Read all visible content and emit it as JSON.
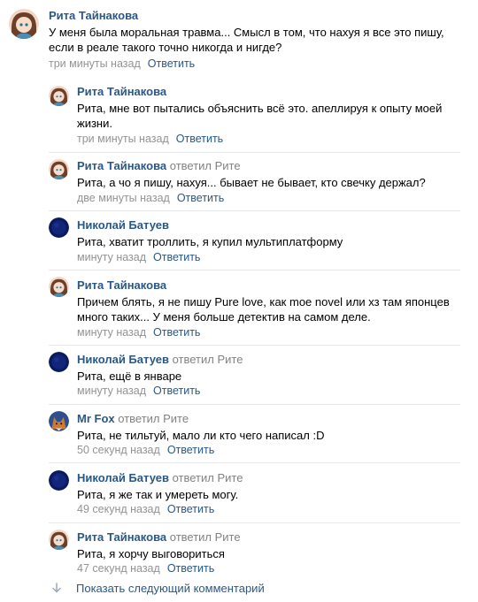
{
  "comments": [
    {
      "author": "Рита Тайнакова",
      "reply_to": "",
      "text": "У меня была моральная травма... Смысл в том, что нахуя я все это пишу, если в реале такого точно никогда и нигде?",
      "time": "три минуты назад",
      "reply_label": "Ответить",
      "avatar": "rita"
    },
    {
      "author": "Рита Тайнакова",
      "reply_to": "",
      "text": "Рита, мне вот пытались объяснить всё это. апеллируя к опыту моей жизни.",
      "time": "три минуты назад",
      "reply_label": "Ответить",
      "avatar": "rita"
    },
    {
      "author": "Рита Тайнакова",
      "reply_to": "ответил Рите",
      "text": "Рита, а чо я пишу, нахуя... бывает не бывает, кто свечку держал?",
      "time": "две минуты назад",
      "reply_label": "Ответить",
      "avatar": "rita"
    },
    {
      "author": "Николай Батуев",
      "reply_to": "",
      "text": "Рита, хватит троллить, я купил мультиплатформу",
      "time": "минуту назад",
      "reply_label": "Ответить",
      "avatar": "nikolai"
    },
    {
      "author": "Рита Тайнакова",
      "reply_to": "",
      "text": "Причем блять, я не пишу Pure love, как moe novel или хз там японцев много таких... У меня больше детектив на самом деле.",
      "time": "минуту назад",
      "reply_label": "Ответить",
      "avatar": "rita"
    },
    {
      "author": "Николай Батуев",
      "reply_to": "ответил Рите",
      "text": "Рита, ещё в январе",
      "time": "минуту назад",
      "reply_label": "Ответить",
      "avatar": "nikolai"
    },
    {
      "author": "Mr Fox",
      "reply_to": "ответил Рите",
      "text": "Рита, не тильтуй, мало ли кто чего написал :D",
      "time": "50 секунд назад",
      "reply_label": "Ответить",
      "avatar": "fox"
    },
    {
      "author": "Николай Батуев",
      "reply_to": "ответил Рите",
      "text": "Рита, я же так и умереть могу.",
      "time": "49 секунд назад",
      "reply_label": "Ответить",
      "avatar": "nikolai"
    },
    {
      "author": "Рита Тайнакова",
      "reply_to": "ответил Рите",
      "text": "Рита, я хорчу выговориться",
      "time": "47 секунд назад",
      "reply_label": "Ответить",
      "avatar": "rita"
    }
  ],
  "show_next_label": "Показать следующий комментарий",
  "colors": {
    "link": "#2a5885",
    "meta": "#939393",
    "divider": "#e7e8ec"
  }
}
